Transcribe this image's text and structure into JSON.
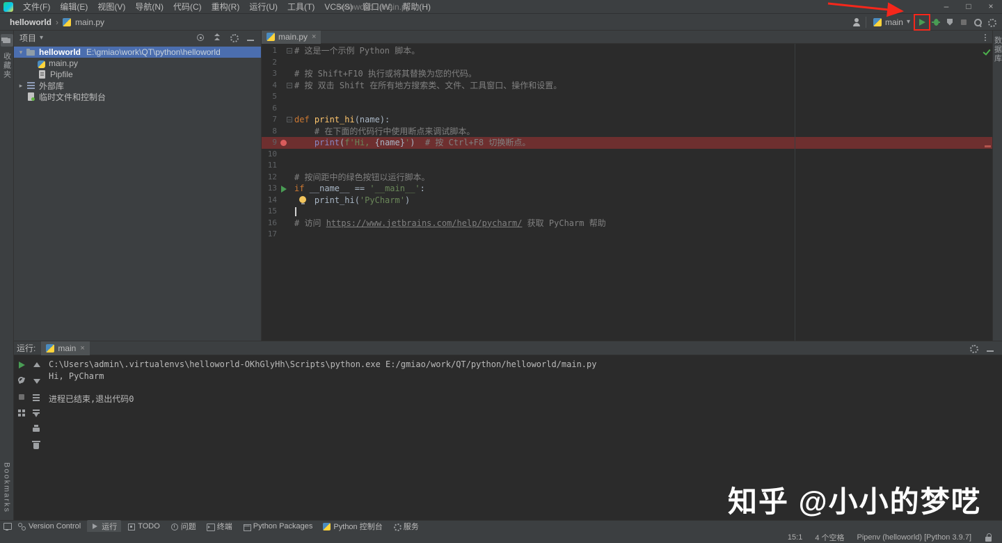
{
  "titlebar": {
    "title": "helloworld - main.py",
    "menus": [
      "文件(F)",
      "编辑(E)",
      "视图(V)",
      "导航(N)",
      "代码(C)",
      "重构(R)",
      "运行(U)",
      "工具(T)",
      "VCS(S)",
      "窗口(W)",
      "帮助(H)"
    ]
  },
  "icons": {
    "minimize": "–",
    "maximize": "□",
    "close": "×",
    "chevron_down": "▾",
    "crumb_sep": "›",
    "tab_close": "×"
  },
  "colors": {
    "selection_blue": "#4b6eaf",
    "breakpoint_line": "#6e2f2f",
    "run_green": "#499c54",
    "annotation_red": "#f5271b"
  },
  "navbar": {
    "project_crumb": "helloworld",
    "file_crumb": "main.py",
    "run_config": "main"
  },
  "stripes": {
    "left_top_label": "收藏夹",
    "left_bottom_label": "Bookmarks",
    "right_top_label": "数据库"
  },
  "project_panel": {
    "title": "项目",
    "tree": [
      {
        "label": "helloworld",
        "path": "E:\\gmiao\\work\\QT\\python\\helloworld",
        "icon": "folder",
        "arrow": "▾",
        "selected": true,
        "indent": 0
      },
      {
        "label": "main.py",
        "path": "",
        "icon": "python",
        "arrow": "",
        "selected": false,
        "indent": 1
      },
      {
        "label": "Pipfile",
        "path": "",
        "icon": "pipfile",
        "arrow": "",
        "selected": false,
        "indent": 1
      },
      {
        "label": "外部库",
        "path": "",
        "icon": "libraries",
        "arrow": "▸",
        "selected": false,
        "indent": 0
      },
      {
        "label": "临时文件和控制台",
        "path": "",
        "icon": "scratches",
        "arrow": "",
        "selected": false,
        "indent": 0
      }
    ]
  },
  "editor": {
    "tab": "main.py",
    "lines": [
      {
        "n": "1",
        "fold": true,
        "segs": [
          [
            "com",
            "# 这是一个示例 Python 脚本。"
          ]
        ]
      },
      {
        "n": "2",
        "segs": []
      },
      {
        "n": "3",
        "segs": [
          [
            "com",
            "# 按 Shift+F10 执行或将其替换为您的代码。"
          ]
        ]
      },
      {
        "n": "4",
        "fold": true,
        "segs": [
          [
            "com",
            "# 按 双击 Shift 在所有地方搜索类、文件、工具窗口、操作和设置。"
          ]
        ]
      },
      {
        "n": "5",
        "segs": []
      },
      {
        "n": "6",
        "segs": []
      },
      {
        "n": "7",
        "fold": true,
        "segs": [
          [
            "kw",
            "def "
          ],
          [
            "fn",
            "print_hi"
          ],
          [
            "pl",
            "(name):"
          ]
        ]
      },
      {
        "n": "8",
        "segs": [
          [
            "com",
            "    # 在下面的代码行中使用断点来调试脚本。"
          ]
        ]
      },
      {
        "n": "9",
        "breakpoint": true,
        "segs": [
          [
            "pl",
            "    "
          ],
          [
            "bi",
            "print"
          ],
          [
            "pl",
            "("
          ],
          [
            "str",
            "f'Hi, "
          ],
          [
            "pl",
            "{name}"
          ],
          [
            "str",
            "'"
          ],
          [
            "pl",
            ")  "
          ],
          [
            "com",
            "# 按 Ctrl+F8 切换断点。"
          ]
        ]
      },
      {
        "n": "10",
        "segs": []
      },
      {
        "n": "11",
        "segs": []
      },
      {
        "n": "12",
        "segs": [
          [
            "com",
            "# 按间距中的绿色按钮以运行脚本。"
          ]
        ]
      },
      {
        "n": "13",
        "run": true,
        "segs": [
          [
            "kw",
            "if "
          ],
          [
            "pl",
            "__name__ == "
          ],
          [
            "str",
            "'__main__'"
          ],
          [
            "pl",
            ":"
          ]
        ]
      },
      {
        "n": "14",
        "bulb": true,
        "segs": [
          [
            "pl",
            "    print_hi("
          ],
          [
            "str",
            "'PyCharm'"
          ],
          [
            "pl",
            ")"
          ]
        ]
      },
      {
        "n": "15",
        "caret": true,
        "segs": []
      },
      {
        "n": "16",
        "segs": [
          [
            "com",
            "# 访问 "
          ],
          [
            "link",
            "https://www.jetbrains.com/help/pycharm/"
          ],
          [
            "com",
            " 获取 PyCharm 帮助"
          ]
        ]
      },
      {
        "n": "17",
        "segs": []
      }
    ]
  },
  "run_panel": {
    "label": "运行:",
    "tab": "main",
    "console": [
      "C:\\Users\\admin\\.virtualenvs\\helloworld-OKhGlyHh\\Scripts\\python.exe E:/gmiao/work/QT/python/helloworld/main.py",
      "Hi, PyCharm",
      "",
      "进程已结束,退出代码0"
    ]
  },
  "bottom_bar": {
    "tabs": [
      {
        "label": "Version Control",
        "icon": "vcs",
        "active": false
      },
      {
        "label": "运行",
        "icon": "run",
        "active": true
      },
      {
        "label": "TODO",
        "icon": "todo",
        "active": false
      },
      {
        "label": "问题",
        "icon": "problems",
        "active": false
      },
      {
        "label": "终端",
        "icon": "terminal",
        "active": false
      },
      {
        "label": "Python Packages",
        "icon": "packages",
        "active": false
      },
      {
        "label": "Python 控制台",
        "icon": "pyconsole",
        "active": false
      },
      {
        "label": "服务",
        "icon": "services",
        "active": false
      }
    ]
  },
  "statusbar": {
    "caret": "15:1",
    "indent": "4 个空格",
    "interpreter": "Pipenv (helloworld) [Python 3.9.7]"
  },
  "watermark": "知乎 @小小的梦呓"
}
